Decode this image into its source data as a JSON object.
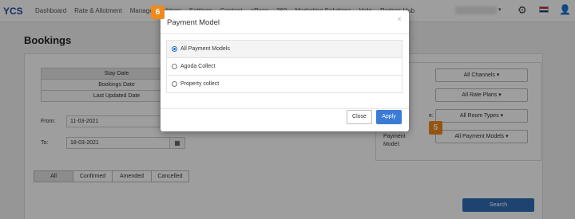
{
  "nav": {
    "logo": "YCS",
    "items": [
      "Dashboard",
      "Rate & Allotment",
      "Manage Bookings",
      "Settings",
      "Content",
      "ePass",
      "360",
      "Marketing Solutions",
      "Help",
      "Partner Hub"
    ]
  },
  "page": {
    "title": "Bookings"
  },
  "filters": {
    "date_types": [
      "Stay Date",
      "Bookings Date",
      "Last Updated Date"
    ],
    "from_label": "From:",
    "from_value": "11-03-2021",
    "to_label": "To:",
    "to_value": "18-03-2021",
    "statuses": [
      "All",
      "Confirmed",
      "Amended",
      "Cancelled"
    ]
  },
  "right": {
    "channels": "All Channels ▾",
    "rate_plans": "All Rate Plans ▾",
    "room_label": "e:",
    "room_types": "All Room Types ▾",
    "payment_label_1": "Payment",
    "payment_label_2": "Model:",
    "payment_models": "All Payment Models ▾"
  },
  "search_label": "Search",
  "badges": {
    "modal": "6",
    "payment": "5"
  },
  "modal": {
    "title": "Payment Model",
    "close_x": "×",
    "options": [
      "All Payment Models",
      "Agoda Collect",
      "Property collect"
    ],
    "selected_index": 0,
    "close_btn": "Close",
    "apply_btn": "Apply"
  },
  "icons": {
    "gear": "gear-icon",
    "flag": "uk-flag-icon",
    "user": "user-icon",
    "calendar": "calendar-icon"
  }
}
